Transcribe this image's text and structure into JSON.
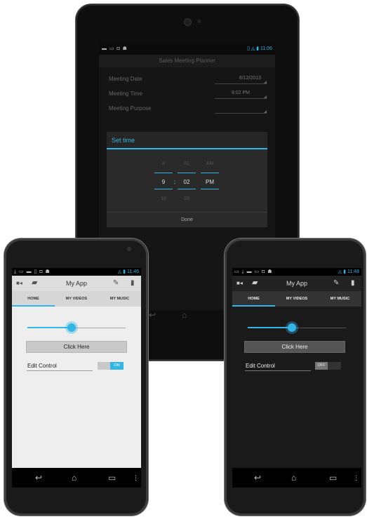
{
  "tablet": {
    "status_icons_left": "▬ ▭ ◘ ☗",
    "status_icons_right": "▯ ◬ ▮ 11:06",
    "app_title": "Sales Meeting Planner",
    "rows": [
      {
        "label": "Meeting Date",
        "value": "8/12/2013"
      },
      {
        "label": "Meeting Time",
        "value": "9:02 PM"
      },
      {
        "label": "Meeting Purpose",
        "value": ""
      }
    ],
    "dialog": {
      "title": "Set time",
      "hour": {
        "prev": "8",
        "current": "9",
        "next": "10"
      },
      "minute": {
        "prev": "01",
        "current": "02",
        "next": "03"
      },
      "ampm": {
        "prev": "AM",
        "current": "PM"
      },
      "separator": ":",
      "done_label": "Done"
    }
  },
  "phone_light": {
    "status_icons_left": "⤓ ▭ ▬ ▯ ◘ ☗",
    "status_icons_right": "◬ ▮ 11:46",
    "title": "My App",
    "tabs": [
      "HOME",
      "MY VIDEOS",
      "MY MUSIC"
    ],
    "active_tab": 0,
    "slider_value_fraction": 0.45,
    "button_label": "Click Here",
    "edit_label": "Edit Control",
    "toggle_state": "ON",
    "toggle_off_text": "",
    "colors": {
      "accent": "#33b5e5",
      "background": "#eeeeee",
      "bar": "#dddddd"
    }
  },
  "phone_dark": {
    "status_icons_left": "▭ ⤓ ▬ ▭ ◘ ☗",
    "status_icons_right": "◬ ▮ 11:48",
    "title": "My App",
    "tabs": [
      "HOME",
      "MY VIDEOS",
      "MY MUSIC"
    ],
    "active_tab": 0,
    "slider_value_fraction": 0.45,
    "button_label": "Click Here",
    "edit_label": "Edit Control",
    "toggle_state": "OFF",
    "colors": {
      "accent": "#33b5e5",
      "background": "#1a1a1a",
      "bar": "#222222"
    }
  },
  "icons": {
    "camera": "■◂",
    "folder": "▰",
    "pencil": "✎",
    "trash": "▮",
    "back": "↩",
    "home": "⌂",
    "recent": "▭",
    "menu": "⋮"
  }
}
